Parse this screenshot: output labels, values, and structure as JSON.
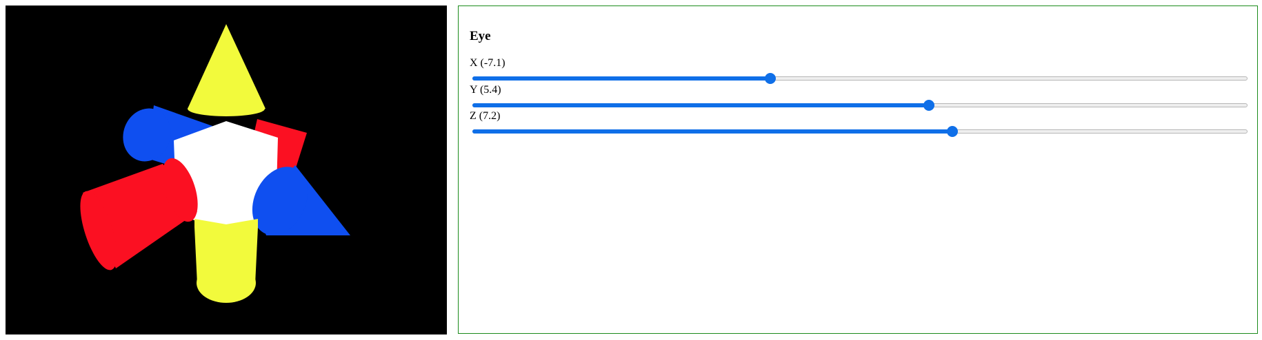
{
  "scene": {
    "background_color": "#000000",
    "shapes": [
      {
        "name": "cone-top",
        "color": "#f2fa3c"
      },
      {
        "name": "cylinder-back-left",
        "color": "#0f4ff0"
      },
      {
        "name": "box-back-right",
        "color": "#fb1022"
      },
      {
        "name": "cube-center",
        "color": "#ffffff"
      },
      {
        "name": "cylinder-front-left",
        "color": "#fb1022"
      },
      {
        "name": "cone-right",
        "color": "#0f4ff0"
      },
      {
        "name": "cylinder-bottom",
        "color": "#f2fa3c"
      }
    ]
  },
  "panel": {
    "title": "Eye",
    "border_color": "#1a8a1a",
    "accent_color": "#0f6fe8",
    "sliders": [
      {
        "key": "x",
        "label": "X (-7.1)",
        "fraction": 0.384
      },
      {
        "key": "y",
        "label": "Y (5.4)",
        "fraction": 0.589
      },
      {
        "key": "z",
        "label": "Z (7.2)",
        "fraction": 0.619
      }
    ]
  }
}
